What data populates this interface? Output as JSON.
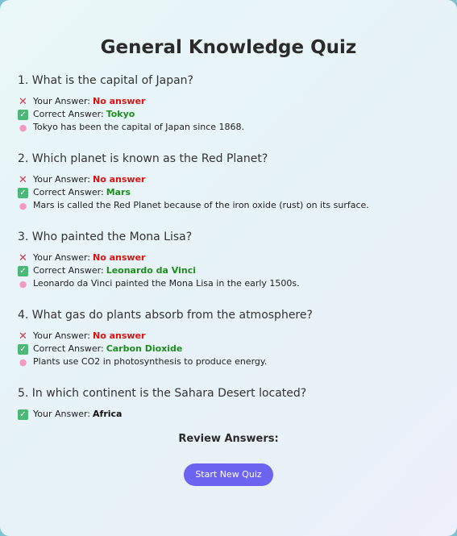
{
  "title": "General Knowledge Quiz",
  "labels": {
    "your_answer": "Your Answer:",
    "correct_answer": "Correct Answer:"
  },
  "icons": {
    "wrong": "cross-mark-icon",
    "correct": "check-mark-icon",
    "explanation": "brain-icon"
  },
  "questions": [
    {
      "title": "1. What is the capital of Japan?",
      "your_answer": "No answer",
      "correct_answer": "Tokyo",
      "explanation": "Tokyo has been the capital of Japan since 1868."
    },
    {
      "title": "2. Which planet is known as the Red Planet?",
      "your_answer": "No answer",
      "correct_answer": "Mars",
      "explanation": "Mars is called the Red Planet because of the iron oxide (rust) on its surface."
    },
    {
      "title": "3. Who painted the Mona Lisa?",
      "your_answer": "No answer",
      "correct_answer": "Leonardo da Vinci",
      "explanation": "Leonardo da Vinci painted the Mona Lisa in the early 1500s."
    },
    {
      "title": "4. What gas do plants absorb from the atmosphere?",
      "your_answer": "No answer",
      "correct_answer": "Carbon Dioxide",
      "explanation": "Plants use CO2 in photosynthesis to produce energy."
    },
    {
      "title": "5. In which continent is the Sahara Desert located?",
      "your_answer": "Africa"
    }
  ],
  "review_heading": "Review Answers:",
  "start_button": "Start New Quiz",
  "colors": {
    "wrong": "#e01010",
    "correct": "#1f8c1f",
    "button": "#6c63f0"
  }
}
